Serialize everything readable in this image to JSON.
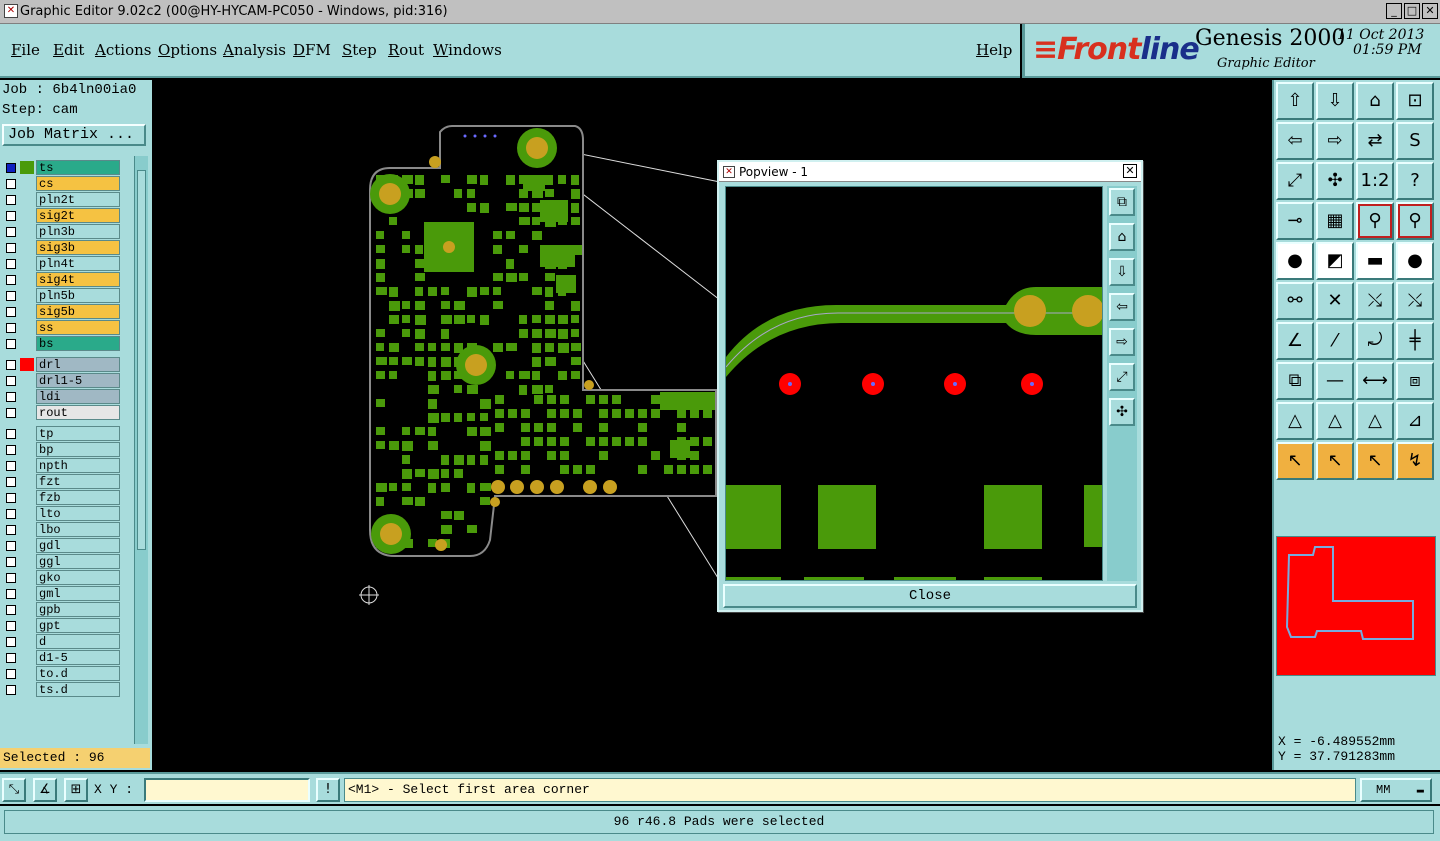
{
  "window": {
    "title": "Graphic Editor 9.02c2 (00@HY-HYCAM-PC050 - Windows, pid:316)"
  },
  "menu": [
    "File",
    "Edit",
    "Actions",
    "Options",
    "Analysis",
    "DFM",
    "Step",
    "Rout",
    "Windows"
  ],
  "help_label": "Help",
  "brand": {
    "logo_front": "Front",
    "logo_line": "line",
    "product": "Genesis 2000",
    "subtitle": "Graphic Editor",
    "date": "11 Oct 2013",
    "time": "01:59 PM"
  },
  "job": {
    "job_label": "Job : 6b4ln00ia0",
    "step_label": "Step: cam",
    "matrix_button": "Job Matrix ..."
  },
  "layers": [
    {
      "name": "ts",
      "color": "#2aaa8a",
      "active": true
    },
    {
      "name": "cs",
      "color": "#f5c242"
    },
    {
      "name": "pln2t",
      "color": "#a8dcdc"
    },
    {
      "name": "sig2t",
      "color": "#f5c242"
    },
    {
      "name": "pln3b",
      "color": "#a8dcdc"
    },
    {
      "name": "sig3b",
      "color": "#f5c242"
    },
    {
      "name": "pln4t",
      "color": "#a8dcdc"
    },
    {
      "name": "sig4t",
      "color": "#f5c242"
    },
    {
      "name": "pln5b",
      "color": "#a8dcdc"
    },
    {
      "name": "sig5b",
      "color": "#f5c242"
    },
    {
      "name": "ss",
      "color": "#f5c242"
    },
    {
      "name": "bs",
      "color": "#2aaa8a"
    },
    {
      "name": "drl",
      "color": "#a0b8c4",
      "red": true
    },
    {
      "name": "drl1-5",
      "color": "#a0b8c4"
    },
    {
      "name": "ldi",
      "color": "#a0b8c4"
    },
    {
      "name": "rout",
      "color": "#e6e6e6"
    },
    {
      "name": "tp",
      "color": "#a8dcdc"
    },
    {
      "name": "bp",
      "color": "#a8dcdc"
    },
    {
      "name": "npth",
      "color": "#a8dcdc"
    },
    {
      "name": "fzt",
      "color": "#a8dcdc"
    },
    {
      "name": "fzb",
      "color": "#a8dcdc"
    },
    {
      "name": "lto",
      "color": "#a8dcdc"
    },
    {
      "name": "lbo",
      "color": "#a8dcdc"
    },
    {
      "name": "gdl",
      "color": "#a8dcdc"
    },
    {
      "name": "ggl",
      "color": "#a8dcdc"
    },
    {
      "name": "gko",
      "color": "#a8dcdc"
    },
    {
      "name": "gml",
      "color": "#a8dcdc"
    },
    {
      "name": "gpb",
      "color": "#a8dcdc"
    },
    {
      "name": "gpt",
      "color": "#a8dcdc"
    },
    {
      "name": "d",
      "color": "#a8dcdc"
    },
    {
      "name": "d1-5",
      "color": "#a8dcdc"
    },
    {
      "name": "to.d",
      "color": "#a8dcdc"
    },
    {
      "name": "ts.d",
      "color": "#a8dcdc"
    }
  ],
  "selected_count": "Selected : 96",
  "popview": {
    "title": "Popview - 1",
    "close_label": "Close"
  },
  "coords": {
    "x": "X = -6.489552mm",
    "y": "Y = 37.791283mm"
  },
  "command": {
    "xy_label": "X Y :",
    "xy_value": "",
    "prompt": "<M1> - Select first area corner",
    "unit": "MM"
  },
  "status_message": "96 r46.8 Pads were selected",
  "colors": {
    "panel": "#a8dcdc",
    "copper": "#4a9a0a",
    "pad": "#c8a020",
    "drill": "#ff0000"
  }
}
